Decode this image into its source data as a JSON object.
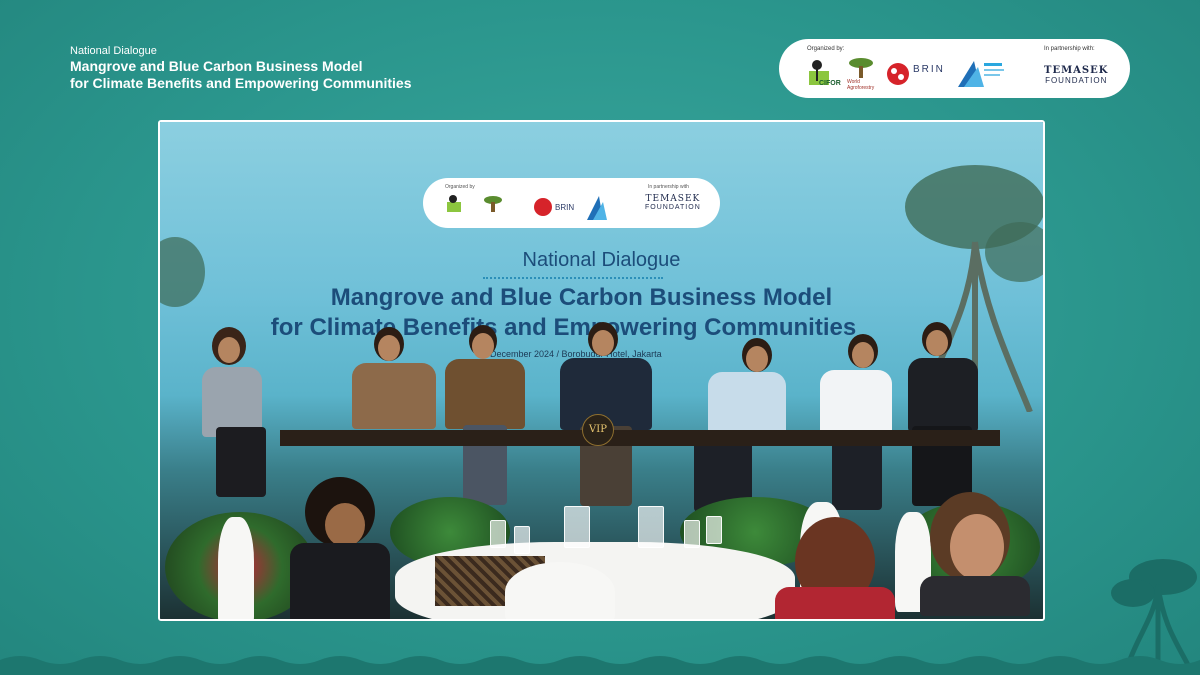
{
  "header": {
    "kicker": "National Dialogue",
    "title_line1": "Mangrove and Blue Carbon Business Model",
    "title_line2": "for Climate Benefits and Empowering Communities"
  },
  "logos": {
    "organized_by_label": "Organized by:",
    "partnership_label": "In partnership with:",
    "cifor": "CIFOR",
    "world_agroforestry": "World Agroforestry",
    "brin": "BRIN",
    "temasek_line1": "TEMASEK",
    "temasek_line2": "FOUNDATION"
  },
  "video": {
    "backdrop_kicker": "National Dialogue",
    "backdrop_title_line1": "Mangrove and Blue Carbon Business Model",
    "backdrop_title_line2": "for Climate Benefits and Empowering Communities",
    "backdrop_date": "December 2024  /  Borobudur Hotel, Jakarta",
    "backdrop_organized_by": "Organized by",
    "backdrop_partnership": "In partnership with",
    "vip_sign": "VIP"
  },
  "colors": {
    "background": "#2f9c93",
    "title_text": "#ffffff",
    "backdrop_title": "#1c4d7a"
  }
}
